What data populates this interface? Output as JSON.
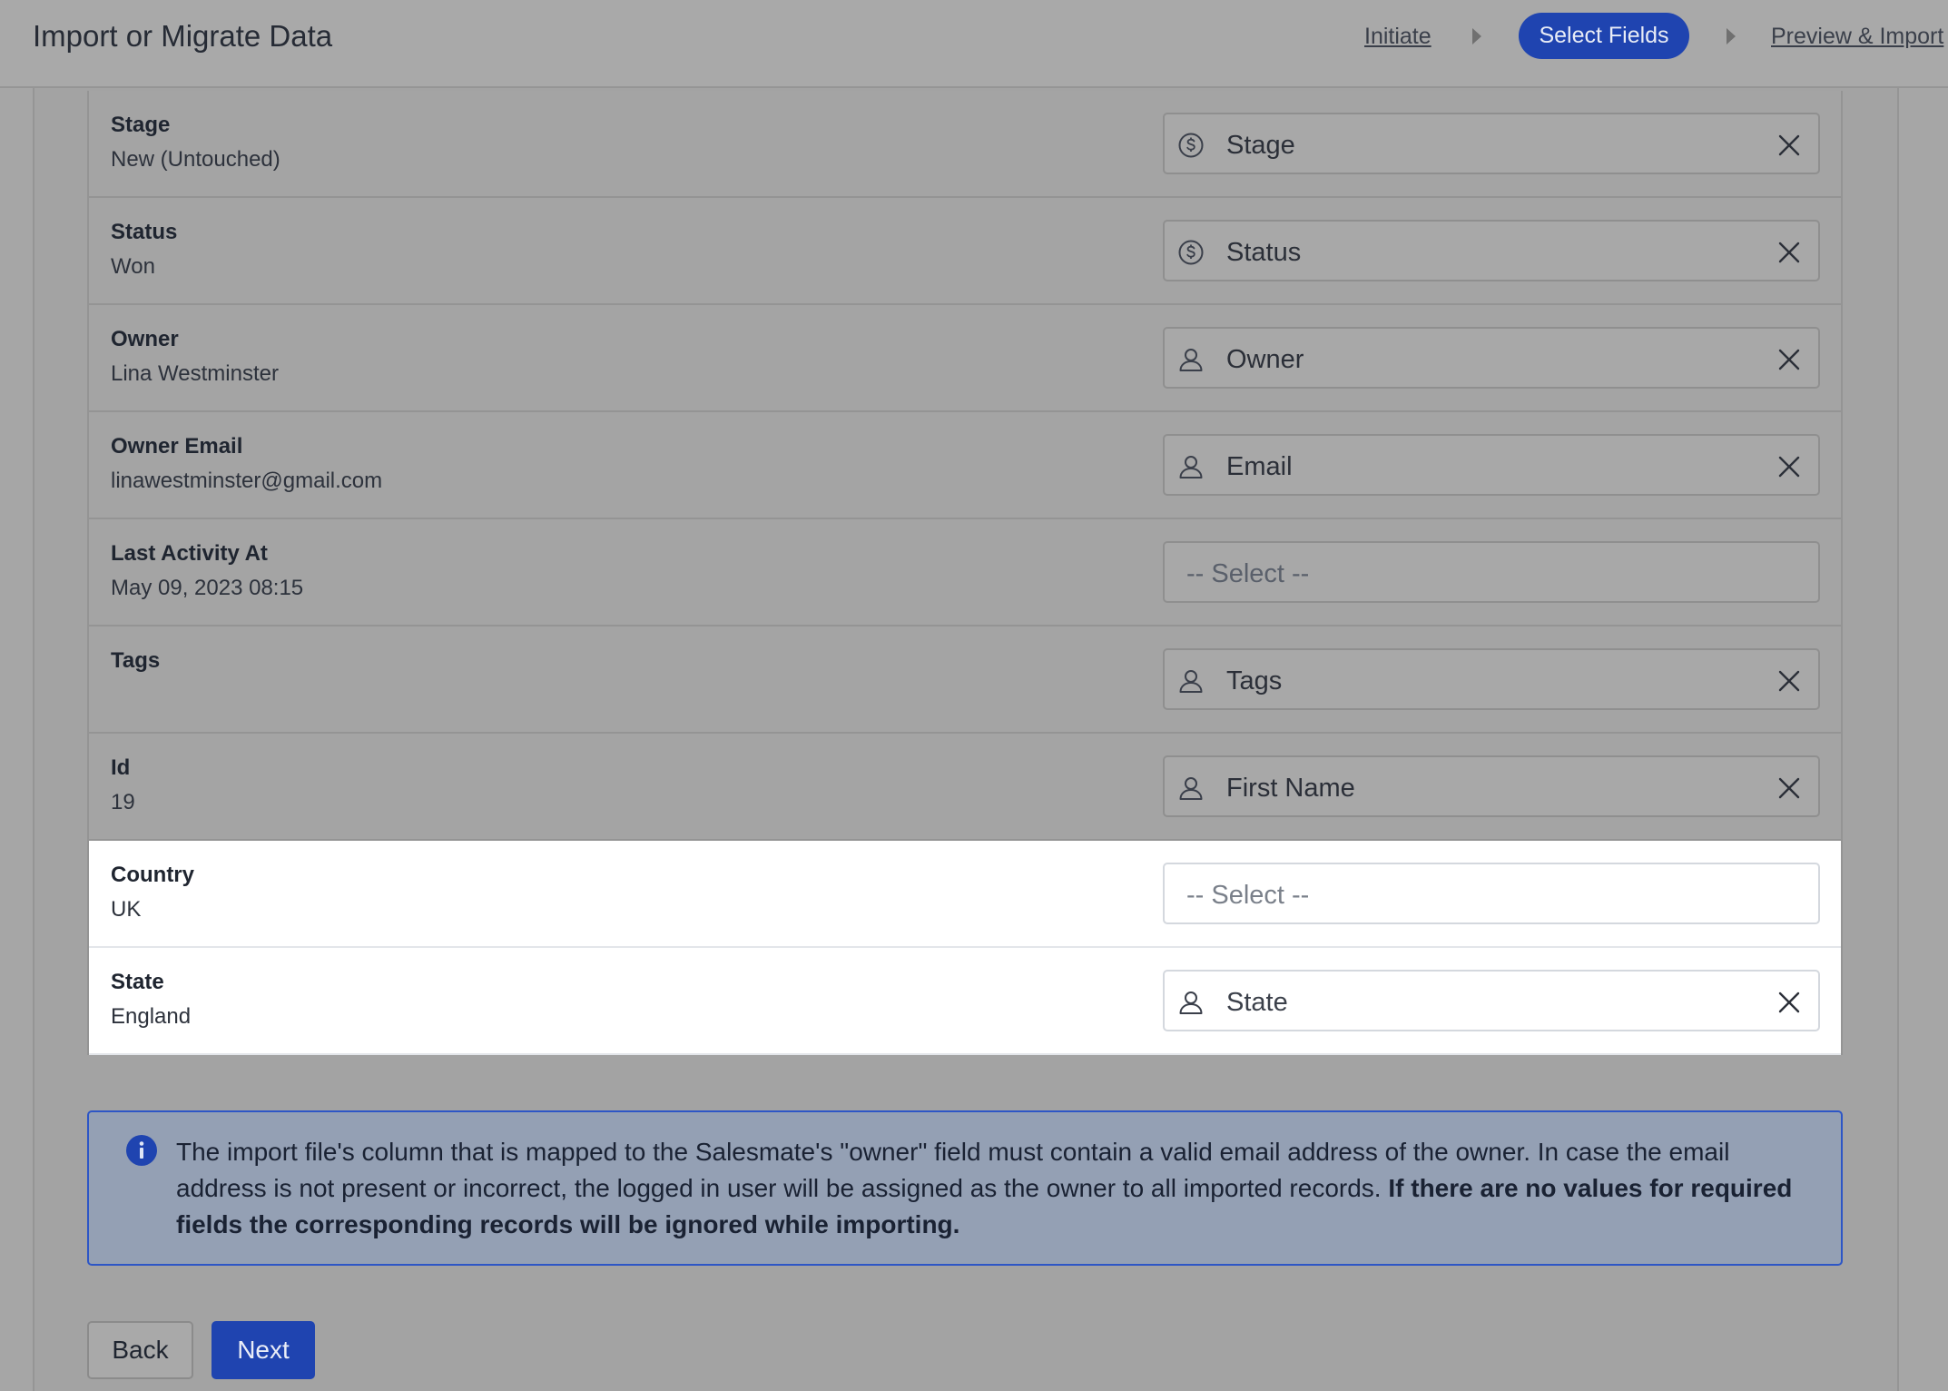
{
  "header": {
    "title": "Import or Migrate Data",
    "steps": [
      {
        "label": "Initiate",
        "state": "done"
      },
      {
        "label": "Select Fields",
        "state": "active"
      },
      {
        "label": "Preview & Import",
        "state": "upcoming"
      }
    ]
  },
  "mapping": {
    "placeholder": "-- Select --",
    "rows": [
      {
        "field": "Stage",
        "sample": "New (Untouched)",
        "mapped": "Stage",
        "icon": "dollar-icon",
        "highlighted": false
      },
      {
        "field": "Status",
        "sample": "Won",
        "mapped": "Status",
        "icon": "dollar-icon",
        "highlighted": false
      },
      {
        "field": "Owner",
        "sample": "Lina Westminster",
        "mapped": "Owner",
        "icon": "user-icon",
        "highlighted": false
      },
      {
        "field": "Owner Email",
        "sample": "linawestminster@gmail.com",
        "mapped": "Email",
        "icon": "user-icon",
        "highlighted": false
      },
      {
        "field": "Last Activity At",
        "sample": "May 09, 2023 08:15",
        "mapped": "",
        "icon": "",
        "highlighted": false
      },
      {
        "field": "Tags",
        "sample": "",
        "mapped": "Tags",
        "icon": "user-icon",
        "highlighted": false
      },
      {
        "field": "Id",
        "sample": "19",
        "mapped": "First Name",
        "icon": "user-icon",
        "highlighted": false
      },
      {
        "field": "Country",
        "sample": "UK",
        "mapped": "",
        "icon": "",
        "highlighted": true
      },
      {
        "field": "State",
        "sample": "England",
        "mapped": "State",
        "icon": "user-icon",
        "highlighted": true
      }
    ]
  },
  "alert": {
    "icon": "info-icon",
    "text": "The import file's column that is mapped to the Salesmate's \"owner\" field must contain a valid email address of the owner. In case the email address is not present or incorrect, the logged in user will be assigned as the owner to all imported records.",
    "bold_text": "If there are no values for required fields the corresponding records will be ignored while importing."
  },
  "footer": {
    "back_label": "Back",
    "next_label": "Next"
  },
  "colors": {
    "primary": "#1f44b0",
    "alert_border": "#2d56c6",
    "overlay": "#a6a6a6"
  }
}
